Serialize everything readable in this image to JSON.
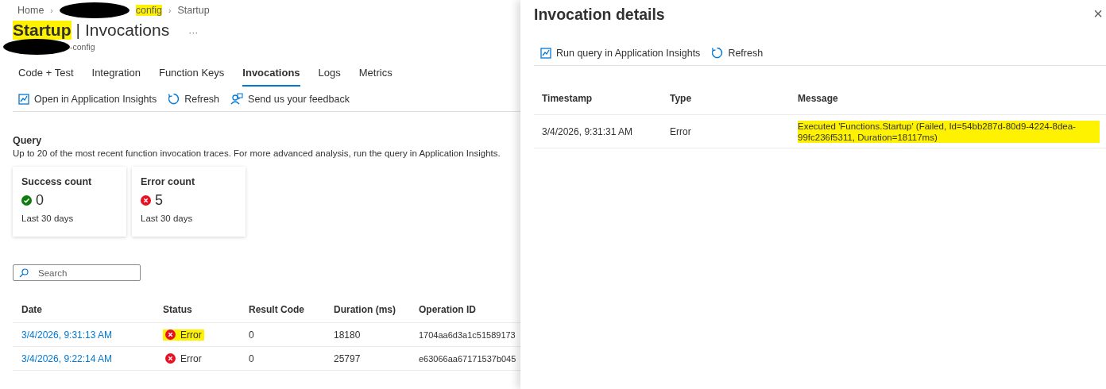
{
  "breadcrumb": [
    {
      "label": "Home",
      "highlighted": false
    },
    {
      "separator": "›",
      "label": "config",
      "highlighted": true,
      "redacted": true
    },
    {
      "separator": "›",
      "label": "Startup",
      "highlighted": false
    }
  ],
  "title": {
    "name": "Startup",
    "separator": "|",
    "section": "Invocations",
    "more": "···",
    "name_highlighted": true
  },
  "subtitle": {
    "text": "-config",
    "redacted": true
  },
  "tabs": [
    {
      "label": "Code + Test",
      "selected": false
    },
    {
      "label": "Integration",
      "selected": false
    },
    {
      "label": "Function Keys",
      "selected": false
    },
    {
      "label": "Invocations",
      "selected": true
    },
    {
      "label": "Logs",
      "selected": false
    },
    {
      "label": "Metrics",
      "selected": false
    }
  ],
  "toolbar": [
    {
      "kind": "insights",
      "label": "Open in Application Insights"
    },
    {
      "kind": "refresh",
      "label": "Refresh"
    },
    {
      "kind": "feedback",
      "label": "Send us your feedback"
    }
  ],
  "query": {
    "heading": "Query",
    "description": "Up to 20 of the most recent function invocation traces. For more advanced analysis, run the query in Application Insights."
  },
  "cards": [
    {
      "title": "Success count",
      "kind": "success",
      "value": "0",
      "period": "Last 30 days"
    },
    {
      "title": "Error count",
      "kind": "error",
      "value": "5",
      "period": "Last 30 days"
    }
  ],
  "search": {
    "placeholder": "Search"
  },
  "table": {
    "columns": [
      "Date",
      "Status",
      "Result Code",
      "Duration (ms)",
      "Operation ID"
    ],
    "rows": [
      {
        "date": "3/4/2026, 9:31:13 AM",
        "status": "Error",
        "kind": "error",
        "highlighted": true,
        "result_code": "0",
        "duration": "18180",
        "operation_id": "1704aa6d3a1c51589173"
      },
      {
        "date": "3/4/2026, 9:22:14 AM",
        "status": "Error",
        "kind": "error",
        "highlighted": false,
        "result_code": "0",
        "duration": "25797",
        "operation_id": "e63066aa67171537b045"
      }
    ]
  },
  "details": {
    "title": "Invocation details",
    "close": "×",
    "toolbar": [
      {
        "kind": "insights",
        "label": "Run query in Application Insights"
      },
      {
        "kind": "refresh",
        "label": "Refresh"
      }
    ],
    "columns": [
      "Timestamp",
      "Type",
      "Message"
    ],
    "rows": [
      {
        "timestamp": "3/4/2026, 9:31:31 AM",
        "type": "Error",
        "message": "Executed 'Functions.Startup' (Failed, Id=54bb287d-80d9-4224-8dea-99fc236f5311, Duration=18117ms)",
        "highlighted": true
      }
    ]
  }
}
